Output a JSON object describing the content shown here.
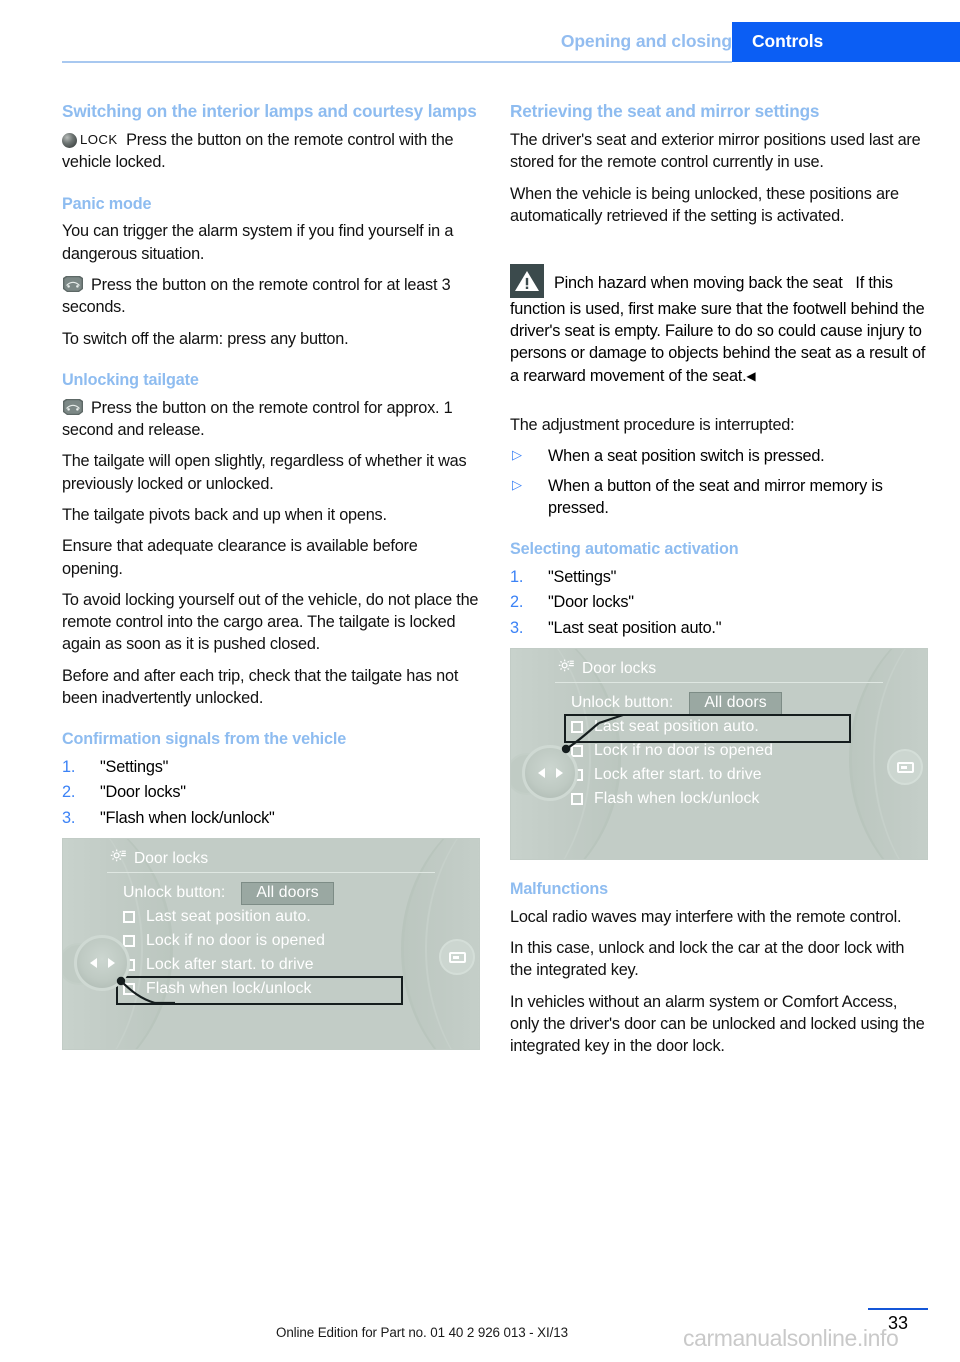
{
  "header": {
    "chapter": "Opening and closing",
    "section": "Controls",
    "accent_blue": "#0b5ef4",
    "muted_blue": "#93bdf0"
  },
  "left_column": {
    "heading_interior_lamps": "Switching on the interior lamps and courtesy lamps",
    "lock_symbol_label": "LOCK",
    "lock_para": "Press the button on the remote control with the vehicle locked.",
    "heading_panic": "Panic mode",
    "panic_para1": "You can trigger the alarm system if you find yourself in a dangerous situation.",
    "panic_para2": "Press the button on the remote control for at least 3 seconds.",
    "panic_para3": "To switch off the alarm: press any button.",
    "heading_tailgate": "Unlocking tailgate",
    "tailgate_para1": "Press the button on the remote control for approx. 1 second and release.",
    "tailgate_para2": "The tailgate will open slightly, regardless of whether it was previously locked or unlocked.",
    "tailgate_para3": "The tailgate pivots back and up when it opens.",
    "tailgate_para4": "Ensure that adequate clearance is available before opening.",
    "tailgate_para5": "To avoid locking yourself out of the vehicle, do not place the remote control into the cargo area. The tailgate is locked again as soon as it is pushed closed.",
    "tailgate_para6": "Before and after each trip, check that the tailgate has not been inadvertently unlocked.",
    "heading_confirmation": "Confirmation signals from the vehicle",
    "confirmation_steps": [
      {
        "num": "1.",
        "text": "\"Settings\""
      },
      {
        "num": "2.",
        "text": "\"Door locks\""
      },
      {
        "num": "3.",
        "text": "\"Flash when lock/unlock\""
      }
    ]
  },
  "right_column": {
    "heading_retrieving": "Retrieving the seat and mirror settings",
    "retrieving_para1": "The driver's seat and exterior mirror positions used last are stored for the remote control currently in use.",
    "retrieving_para2": "When the vehicle is being unlocked, these positions are automatically retrieved if the setting is activated.",
    "warning_title": "Pinch hazard when moving back the seat",
    "warning_body": "If this function is used, first make sure that the footwell behind the driver's seat is empty. Failure to do so could cause injury to persons or damage to objects behind the seat as a result of a rearward movement of the seat.",
    "warning_end_mark": "◀",
    "interrupt_intro": "The adjustment procedure is interrupted:",
    "interrupt_items": [
      "When a seat position switch is pressed.",
      "When a button of the seat and mirror memory is pressed."
    ],
    "heading_selecting": "Selecting automatic activation",
    "selecting_steps": [
      {
        "num": "1.",
        "text": "\"Settings\""
      },
      {
        "num": "2.",
        "text": "\"Door locks\""
      },
      {
        "num": "3.",
        "text": "\"Last seat position auto.\""
      }
    ],
    "heading_malfunctions": "Malfunctions",
    "malfunctions_para1": "Local radio waves may interfere with the remote control.",
    "malfunctions_para2": "In this case, unlock and lock the car at the door lock with the integrated key.",
    "malfunctions_para3": "In vehicles without an alarm system or Comfort Access, only the driver's door can be unlocked and locked using the integrated key in the door lock."
  },
  "idrive_left": {
    "title": "Door locks",
    "unlock_label": "Unlock button:",
    "unlock_value": "All doors",
    "options": [
      "Last seat position auto.",
      "Lock if no door is opened",
      "Lock after start. to drive",
      "Flash when lock/unlock"
    ],
    "selected_index": 3
  },
  "idrive_right": {
    "title": "Door locks",
    "unlock_label": "Unlock button:",
    "unlock_value": "All doors",
    "options": [
      "Last seat position auto.",
      "Lock if no door is opened",
      "Lock after start. to drive",
      "Flash when lock/unlock"
    ],
    "selected_index": 0
  },
  "footer": {
    "page_number": "33",
    "edition_note": "Online Edition for Part no. 01 40 2 926 013 - XI/13",
    "watermark": "carmanualsonline.info"
  }
}
